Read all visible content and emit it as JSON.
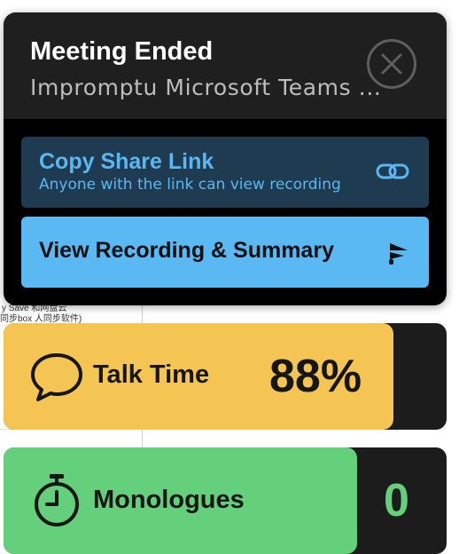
{
  "background_app": {
    "fragment_line1": "y Save 和网盘云",
    "fragment_line2": "同步box 人同步软件)"
  },
  "meeting_card": {
    "title": "Meeting Ended",
    "subtitle": "Impromptu Microsoft Teams ...",
    "close_icon": "close-icon",
    "copy_share": {
      "title": "Copy Share Link",
      "subtitle": "Anyone with the link can view recording",
      "icon": "link-icon"
    },
    "view_recording": {
      "label": "View Recording & Summary",
      "icon": "brand-logo-icon"
    }
  },
  "metrics": {
    "talk_time": {
      "label": "Talk Time",
      "value": "88%",
      "icon": "speech-bubble-icon",
      "fill_fraction": 0.88
    },
    "monologues": {
      "label": "Monologues",
      "value": "0",
      "icon": "stopwatch-icon"
    }
  },
  "colors": {
    "card_bg": "#000000",
    "header_bg": "#1f1f1f",
    "copy_bg": "#1e3b52",
    "accent_blue": "#5ab8f3",
    "talk_yellow": "#f4c553",
    "mono_green": "#64d07c",
    "dark_tile": "#1c1c1c"
  }
}
